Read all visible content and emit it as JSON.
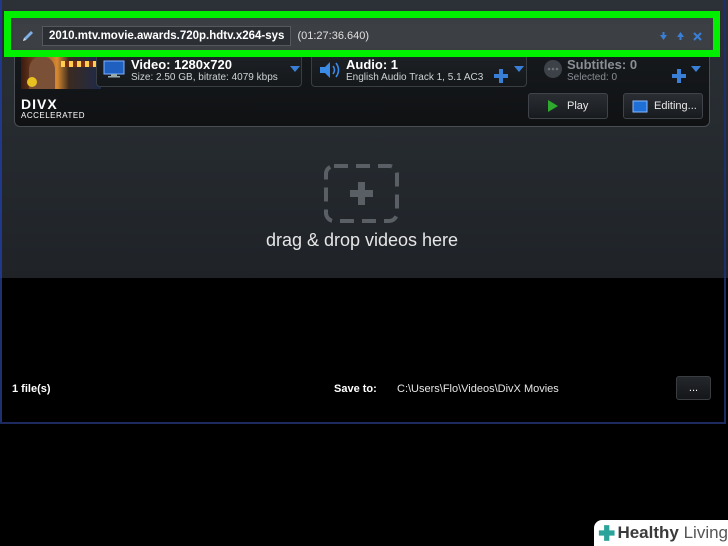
{
  "file": {
    "name": "2010.mtv.movie.awards.720p.hdtv.x264-sys",
    "duration": "(01:27:36.640)"
  },
  "video": {
    "title": "Video: 1280x720",
    "details": "Size: 2.50 GB, bitrate: 4079 kbps"
  },
  "audio": {
    "title": "Audio: 1",
    "details": "English Audio Track 1, 5.1 AC3"
  },
  "subtitles": {
    "title": "Subtitles: 0",
    "details": "Selected: 0"
  },
  "logo": {
    "brand": "DIVX",
    "tagline": "ACCELERATED"
  },
  "buttons": {
    "play": "Play",
    "editing": "Editing..."
  },
  "dropzone": {
    "text": "drag & drop videos here"
  },
  "footer": {
    "file_count": "1 file(s)",
    "save_label": "Save to:",
    "save_path": "C:\\Users\\Flo\\Videos\\DivX Movies",
    "browse": "..."
  },
  "watermark": {
    "healthy": "Healthy",
    "living": " Living"
  },
  "colors": {
    "highlight": "#00f000",
    "accent_blue": "#3a7fd6",
    "play_green": "#2fa82f"
  }
}
